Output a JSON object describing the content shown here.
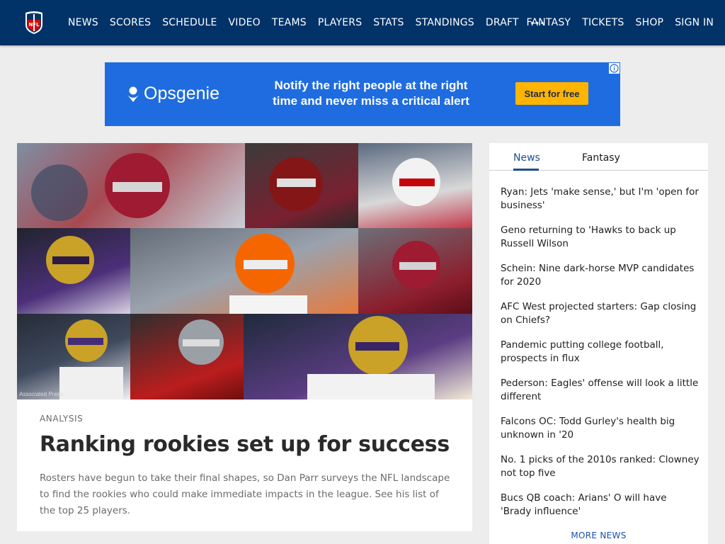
{
  "nav": {
    "logo_icon": "nfl-shield-logo-icon",
    "links": [
      "NEWS",
      "SCORES",
      "SCHEDULE",
      "VIDEO",
      "TEAMS",
      "PLAYERS",
      "STATS",
      "STANDINGS",
      "DRAFT"
    ],
    "more": "···",
    "right_links": [
      "FANTASY",
      "TICKETS",
      "SHOP",
      "SIGN IN"
    ]
  },
  "ad": {
    "brand": "Opsgenie",
    "brand_icon": "opsgenie-pin-icon",
    "message": "Notify the right people at the right time and never miss a critical alert",
    "cta": "Start for free",
    "info_icon": "adchoices-info-icon"
  },
  "hero": {
    "credit": "Associated Press",
    "eyebrow": "ANALYSIS",
    "headline": "Ranking rookies set up for success",
    "dek": "Rosters have begun to take their final shapes, so Dan Parr surveys the NFL landscape to find the rookies who could make immediate impacts in the league. See his list of the top 25 players."
  },
  "sidebar": {
    "tabs": [
      "News",
      "Fantasy"
    ],
    "active_tab": "News",
    "items": [
      "Ryan: Jets 'make sense,' but I'm 'open for business'",
      "Geno returning to 'Hawks to back up Russell Wilson",
      "Schein: Nine dark-horse MVP candidates for 2020",
      "AFC West projected starters: Gap closing on Chiefs?",
      "Pandemic putting college football, prospects in flux",
      "Pederson: Eagles' offense will look a little different",
      "Falcons OC: Todd Gurley's health big unknown in '20",
      "No. 1 picks of the 2010s ranked: Clowney not top five",
      "Bucs QB coach: Arians' O will have 'Brady influence'"
    ],
    "more": "MORE NEWS"
  },
  "colors": {
    "nav_bg": "#013369",
    "ad_bg": "#1f6ce0",
    "ad_cta": "#ffb400",
    "link_blue": "#1b4fb0",
    "page_bg": "#ededed"
  }
}
